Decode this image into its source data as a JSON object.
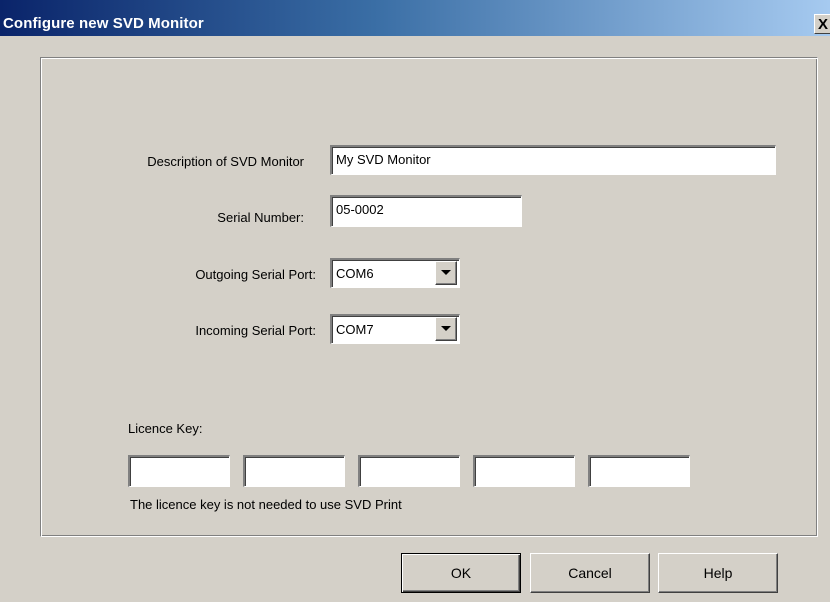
{
  "window": {
    "title": "Configure new SVD Monitor",
    "close_label": "X"
  },
  "form": {
    "description_label": "Description of SVD Monitor",
    "description_value": "My SVD Monitor",
    "serial_label": "Serial Number:",
    "serial_value": "05-0002",
    "outgoing_label": "Outgoing Serial Port:",
    "outgoing_value": "COM6",
    "incoming_label": "Incoming Serial Port:",
    "incoming_value": "COM7",
    "licence_label": "Licence Key:",
    "licence_values": [
      "",
      "",
      "",
      "",
      ""
    ],
    "licence_note": "The licence key is not needed to use SVD Print"
  },
  "buttons": {
    "ok": "OK",
    "cancel": "Cancel",
    "help": "Help"
  },
  "colors": {
    "title_bar_start": "#0a246a",
    "title_bar_end": "#a6caf0",
    "face": "#d4d0c8"
  },
  "icons": {
    "close": "close-icon",
    "dropdown": "chevron-down-icon"
  }
}
